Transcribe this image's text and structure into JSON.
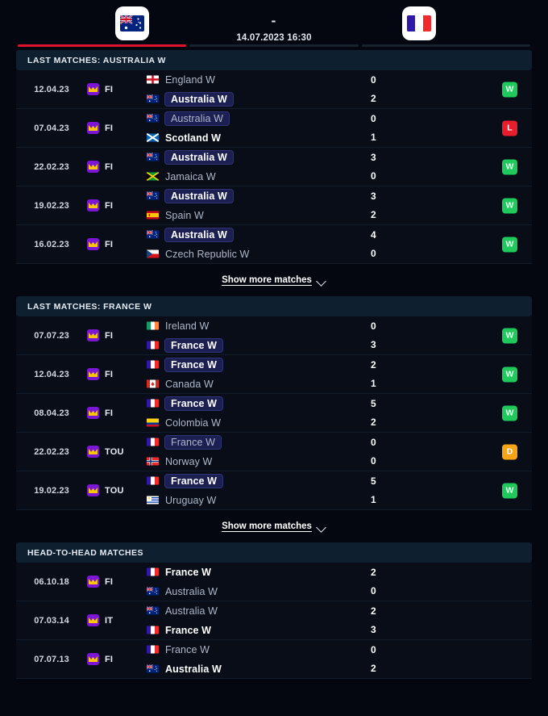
{
  "header": {
    "home_team": "Australia W",
    "home_flag": "au",
    "away_team": "France W",
    "away_flag": "fr",
    "score_separator": "-",
    "datetime": "14.07.2023 16:30"
  },
  "tabs": [
    {
      "name": "tab-1",
      "active": true
    },
    {
      "name": "tab-2",
      "active": false
    },
    {
      "name": "tab-3",
      "active": false
    }
  ],
  "colors": {
    "accent_active_tab": "#e1122b",
    "result_win": "#1fc95b",
    "result_loss": "#ea1d2c",
    "result_draw": "#f5a415",
    "section_header_bg": "#0e2030",
    "highlight_team_bg": "#1b1f52",
    "page_bg": "#04070f"
  },
  "show_more_label": "Show more matches",
  "sections": [
    {
      "id": "last-matches-australia",
      "title": "LAST MATCHES: AUSTRALIA W",
      "has_show_more": true,
      "matches": [
        {
          "date": "12.04.23",
          "competition": "FI",
          "home": {
            "team": "England W",
            "flag": "en",
            "winner": false,
            "highlight": false
          },
          "away": {
            "team": "Australia W",
            "flag": "au",
            "winner": true,
            "highlight": true
          },
          "score_home": "0",
          "score_away": "2",
          "result": "W"
        },
        {
          "date": "07.04.23",
          "competition": "FI",
          "home": {
            "team": "Australia W",
            "flag": "au",
            "winner": false,
            "highlight": true
          },
          "away": {
            "team": "Scotland W",
            "flag": "sc",
            "winner": true,
            "highlight": false
          },
          "score_home": "0",
          "score_away": "1",
          "result": "L"
        },
        {
          "date": "22.02.23",
          "competition": "FI",
          "home": {
            "team": "Australia W",
            "flag": "au",
            "winner": true,
            "highlight": true
          },
          "away": {
            "team": "Jamaica W",
            "flag": "jm",
            "winner": false,
            "highlight": false
          },
          "score_home": "3",
          "score_away": "0",
          "result": "W"
        },
        {
          "date": "19.02.23",
          "competition": "FI",
          "home": {
            "team": "Australia W",
            "flag": "au",
            "winner": true,
            "highlight": true
          },
          "away": {
            "team": "Spain W",
            "flag": "es",
            "winner": false,
            "highlight": false
          },
          "score_home": "3",
          "score_away": "2",
          "result": "W"
        },
        {
          "date": "16.02.23",
          "competition": "FI",
          "home": {
            "team": "Australia W",
            "flag": "au",
            "winner": true,
            "highlight": true
          },
          "away": {
            "team": "Czech Republic W",
            "flag": "cz",
            "winner": false,
            "highlight": false
          },
          "score_home": "4",
          "score_away": "0",
          "result": "W"
        }
      ]
    },
    {
      "id": "last-matches-france",
      "title": "LAST MATCHES: FRANCE W",
      "has_show_more": true,
      "matches": [
        {
          "date": "07.07.23",
          "competition": "FI",
          "home": {
            "team": "Ireland W",
            "flag": "ie",
            "winner": false,
            "highlight": false
          },
          "away": {
            "team": "France W",
            "flag": "fr",
            "winner": true,
            "highlight": true
          },
          "score_home": "0",
          "score_away": "3",
          "result": "W"
        },
        {
          "date": "12.04.23",
          "competition": "FI",
          "home": {
            "team": "France W",
            "flag": "fr",
            "winner": true,
            "highlight": true
          },
          "away": {
            "team": "Canada W",
            "flag": "ca",
            "winner": false,
            "highlight": false
          },
          "score_home": "2",
          "score_away": "1",
          "result": "W"
        },
        {
          "date": "08.04.23",
          "competition": "FI",
          "home": {
            "team": "France W",
            "flag": "fr",
            "winner": true,
            "highlight": true
          },
          "away": {
            "team": "Colombia W",
            "flag": "co",
            "winner": false,
            "highlight": false
          },
          "score_home": "5",
          "score_away": "2",
          "result": "W"
        },
        {
          "date": "22.02.23",
          "competition": "TOU",
          "home": {
            "team": "France W",
            "flag": "fr",
            "winner": false,
            "highlight": true
          },
          "away": {
            "team": "Norway W",
            "flag": "no",
            "winner": false,
            "highlight": false
          },
          "score_home": "0",
          "score_away": "0",
          "result": "D"
        },
        {
          "date": "19.02.23",
          "competition": "TOU",
          "home": {
            "team": "France W",
            "flag": "fr",
            "winner": true,
            "highlight": true
          },
          "away": {
            "team": "Uruguay W",
            "flag": "uy",
            "winner": false,
            "highlight": false
          },
          "score_home": "5",
          "score_away": "1",
          "result": "W"
        }
      ]
    },
    {
      "id": "head-to-head-matches",
      "title": "HEAD-TO-HEAD MATCHES",
      "has_show_more": false,
      "matches": [
        {
          "date": "06.10.18",
          "competition": "FI",
          "home": {
            "team": "France W",
            "flag": "fr",
            "winner": true,
            "highlight": false
          },
          "away": {
            "team": "Australia W",
            "flag": "au",
            "winner": false,
            "highlight": false
          },
          "score_home": "2",
          "score_away": "0",
          "result": ""
        },
        {
          "date": "07.03.14",
          "competition": "IT",
          "home": {
            "team": "Australia W",
            "flag": "au",
            "winner": false,
            "highlight": false
          },
          "away": {
            "team": "France W",
            "flag": "fr",
            "winner": true,
            "highlight": false
          },
          "score_home": "2",
          "score_away": "3",
          "result": ""
        },
        {
          "date": "07.07.13",
          "competition": "FI",
          "home": {
            "team": "France W",
            "flag": "fr",
            "winner": false,
            "highlight": false
          },
          "away": {
            "team": "Australia W",
            "flag": "au",
            "winner": true,
            "highlight": false
          },
          "score_home": "0",
          "score_away": "2",
          "result": ""
        }
      ]
    }
  ]
}
